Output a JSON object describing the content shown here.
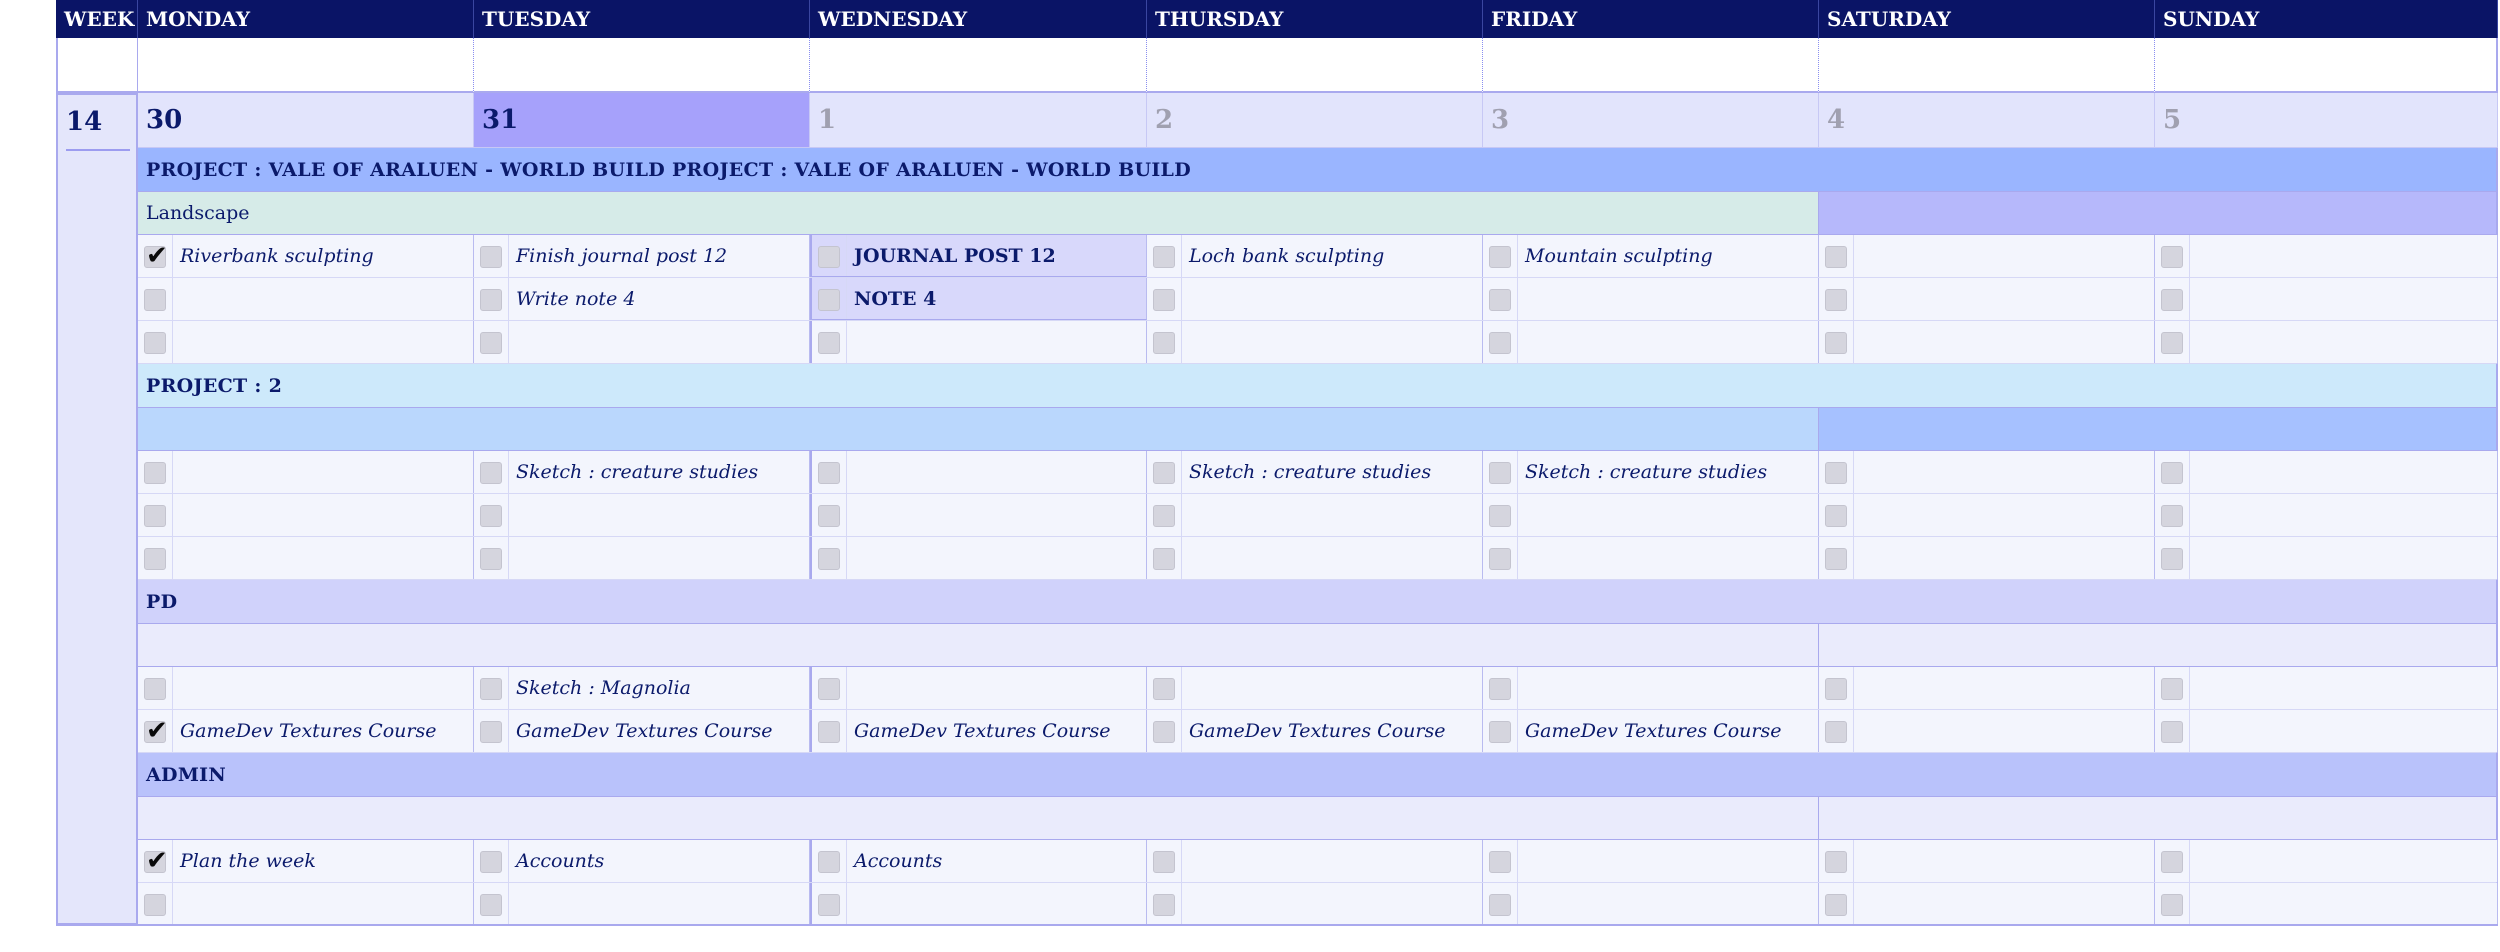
{
  "header": {
    "week_label": "WEEK",
    "days": [
      "MONDAY",
      "TUESDAY",
      "WEDNESDAY",
      "THURSDAY",
      "FRIDAY",
      "SATURDAY",
      "SUNDAY"
    ]
  },
  "week_number": "14",
  "dates": [
    {
      "label": "30",
      "state": "current"
    },
    {
      "label": "31",
      "state": "today"
    },
    {
      "label": "1",
      "state": "next"
    },
    {
      "label": "2",
      "state": "next"
    },
    {
      "label": "3",
      "state": "next"
    },
    {
      "label": "4",
      "state": "next"
    },
    {
      "label": "5",
      "state": "next"
    }
  ],
  "colors": {
    "header_bg": "#0a1466",
    "today_bg": "#a6a1fb",
    "date_bg": "#e2e4fc",
    "text_navy": "#0b1a6b",
    "muted_date": "#a0a0b0"
  },
  "sections": [
    {
      "name": "project-vale",
      "title": "PROJECT : VALE OF ARALUEN - WORLD BUILD PROJECT : VALE OF ARALUEN - WORLD BUILD",
      "title_bg": "#9ab5ff",
      "sub_label": "Landscape",
      "sub_bg_left": "#d6ebe8",
      "sub_bg_right": "#b6b8fb",
      "rows": [
        {
          "cells": [
            {
              "text": "Riverbank sculpting",
              "checked": true
            },
            {
              "text": "Finish journal post 12",
              "checked": false
            },
            {
              "text": "JOURNAL POST 12",
              "checked": false,
              "bold": true,
              "highlight": true
            },
            {
              "text": "Loch bank sculpting",
              "checked": false
            },
            {
              "text": "Mountain sculpting",
              "checked": false
            },
            {
              "text": "",
              "checked": false
            },
            {
              "text": "",
              "checked": false
            }
          ]
        },
        {
          "cells": [
            {
              "text": "",
              "checked": false
            },
            {
              "text": "Write note 4",
              "checked": false
            },
            {
              "text": "NOTE 4",
              "checked": false,
              "bold": true,
              "highlight": true
            },
            {
              "text": "",
              "checked": false
            },
            {
              "text": "",
              "checked": false
            },
            {
              "text": "",
              "checked": false
            },
            {
              "text": "",
              "checked": false
            }
          ]
        },
        {
          "cells": [
            {
              "text": "",
              "checked": false
            },
            {
              "text": "",
              "checked": false
            },
            {
              "text": "",
              "checked": false
            },
            {
              "text": "",
              "checked": false
            },
            {
              "text": "",
              "checked": false
            },
            {
              "text": "",
              "checked": false
            },
            {
              "text": "",
              "checked": false
            }
          ]
        }
      ]
    },
    {
      "name": "project-2",
      "title": "PROJECT : 2",
      "title_bg": "#cde9fb",
      "sub_label": "",
      "sub_bg_left": "#bad7fd",
      "sub_bg_right": "#a6c1ff",
      "rows": [
        {
          "cells": [
            {
              "text": "",
              "checked": false
            },
            {
              "text": "Sketch : creature studies",
              "checked": false
            },
            {
              "text": "",
              "checked": false
            },
            {
              "text": "Sketch : creature studies",
              "checked": false
            },
            {
              "text": "Sketch : creature studies",
              "checked": false
            },
            {
              "text": "",
              "checked": false
            },
            {
              "text": "",
              "checked": false
            }
          ]
        },
        {
          "cells": [
            {
              "text": "",
              "checked": false
            },
            {
              "text": "",
              "checked": false
            },
            {
              "text": "",
              "checked": false
            },
            {
              "text": "",
              "checked": false
            },
            {
              "text": "",
              "checked": false
            },
            {
              "text": "",
              "checked": false
            },
            {
              "text": "",
              "checked": false
            }
          ]
        },
        {
          "cells": [
            {
              "text": "",
              "checked": false
            },
            {
              "text": "",
              "checked": false
            },
            {
              "text": "",
              "checked": false
            },
            {
              "text": "",
              "checked": false
            },
            {
              "text": "",
              "checked": false
            },
            {
              "text": "",
              "checked": false
            },
            {
              "text": "",
              "checked": false
            }
          ]
        }
      ]
    },
    {
      "name": "pd",
      "title": "PD",
      "title_bg": "#d0d2fb",
      "sub_label": "",
      "sub_bg_left": "#eaebfc",
      "sub_bg_right": "#eaebfc",
      "rows": [
        {
          "cells": [
            {
              "text": "",
              "checked": false
            },
            {
              "text": "Sketch : Magnolia",
              "checked": false
            },
            {
              "text": "",
              "checked": false
            },
            {
              "text": "",
              "checked": false
            },
            {
              "text": "",
              "checked": false
            },
            {
              "text": "",
              "checked": false
            },
            {
              "text": "",
              "checked": false
            }
          ]
        },
        {
          "cells": [
            {
              "text": "GameDev Textures Course",
              "checked": true
            },
            {
              "text": "GameDev Textures Course",
              "checked": false
            },
            {
              "text": "GameDev Textures Course",
              "checked": false
            },
            {
              "text": "GameDev Textures Course",
              "checked": false
            },
            {
              "text": "GameDev Textures Course",
              "checked": false
            },
            {
              "text": "",
              "checked": false
            },
            {
              "text": "",
              "checked": false
            }
          ]
        }
      ]
    },
    {
      "name": "admin",
      "title": "ADMIN",
      "title_bg": "#b9c2fb",
      "sub_label": "",
      "sub_bg_left": "#eaebfc",
      "sub_bg_right": "#eaebfc",
      "rows": [
        {
          "cells": [
            {
              "text": "Plan the week",
              "checked": true
            },
            {
              "text": "Accounts",
              "checked": false
            },
            {
              "text": "Accounts",
              "checked": false
            },
            {
              "text": "",
              "checked": false
            },
            {
              "text": "",
              "checked": false
            },
            {
              "text": "",
              "checked": false
            },
            {
              "text": "",
              "checked": false
            }
          ]
        },
        {
          "cells": [
            {
              "text": "",
              "checked": false
            },
            {
              "text": "",
              "checked": false
            },
            {
              "text": "",
              "checked": false
            },
            {
              "text": "",
              "checked": false
            },
            {
              "text": "",
              "checked": false
            },
            {
              "text": "",
              "checked": false
            },
            {
              "text": "",
              "checked": false
            }
          ]
        }
      ]
    }
  ]
}
